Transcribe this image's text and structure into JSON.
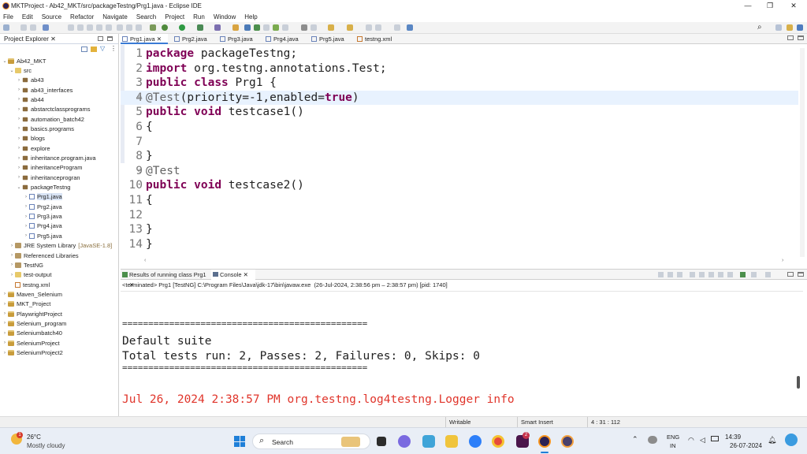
{
  "window": {
    "title": "MKTProject - Ab42_MKT/src/packageTestng/Prg1.java - Eclipse IDE",
    "controls": [
      "—",
      "❐",
      "✕"
    ]
  },
  "menu": [
    "File",
    "Edit",
    "Source",
    "Refactor",
    "Navigate",
    "Search",
    "Project",
    "Run",
    "Window",
    "Help"
  ],
  "explorer": {
    "title": "Project Explorer",
    "close": "✕",
    "tree": [
      {
        "label": "Ab42_MKT",
        "type": "proj",
        "twisty": "⌄"
      },
      {
        "label": "src",
        "type": "fold",
        "twisty": "⌄"
      },
      {
        "label": "ab43",
        "type": "pkg",
        "twisty": "›"
      },
      {
        "label": "ab43_interfaces",
        "type": "pkg",
        "twisty": "›"
      },
      {
        "label": "ab44",
        "type": "pkg",
        "twisty": "›"
      },
      {
        "label": "abstarctclassprograms",
        "type": "pkg",
        "twisty": "›"
      },
      {
        "label": "automation_batch42",
        "type": "pkg",
        "twisty": "›"
      },
      {
        "label": "basics.programs",
        "type": "pkg",
        "twisty": "›"
      },
      {
        "label": "blogs",
        "type": "pkg",
        "twisty": "›"
      },
      {
        "label": "explore",
        "type": "pkg",
        "twisty": "›"
      },
      {
        "label": "inheritance.program.java",
        "type": "pkg",
        "twisty": "›"
      },
      {
        "label": "inheritanceProgram",
        "type": "pkg",
        "twisty": "›"
      },
      {
        "label": "inheritanceprogran",
        "type": "pkg",
        "twisty": "›"
      },
      {
        "label": "packageTestng",
        "type": "pkg",
        "twisty": "⌄"
      },
      {
        "label": "Prg1.java",
        "type": "java",
        "twisty": "›",
        "selected": true
      },
      {
        "label": "Prg2.java",
        "type": "java",
        "twisty": "›"
      },
      {
        "label": "Prg3.java",
        "type": "java",
        "twisty": "›"
      },
      {
        "label": "Prg4.java",
        "type": "java",
        "twisty": "›"
      },
      {
        "label": "Prg5.java",
        "type": "java",
        "twisty": "›"
      },
      {
        "label": "JRE System Library",
        "type": "lib",
        "twisty": "›",
        "suffix": "[JavaSE-1.8]"
      },
      {
        "label": "Referenced Libraries",
        "type": "lib",
        "twisty": "›"
      },
      {
        "label": "TestNG",
        "type": "lib",
        "twisty": "›"
      },
      {
        "label": "test-output",
        "type": "fold",
        "twisty": "›"
      },
      {
        "label": "testng.xml",
        "type": "xml",
        "twisty": ""
      },
      {
        "label": "Maven_Selenium",
        "type": "proj",
        "twisty": "›"
      },
      {
        "label": "MKT_Project",
        "type": "proj",
        "twisty": "›"
      },
      {
        "label": "PlaywrightProject",
        "type": "proj",
        "twisty": "›"
      },
      {
        "label": "Selenium_program",
        "type": "proj",
        "twisty": "›"
      },
      {
        "label": "Seleniumbatch40",
        "type": "proj",
        "twisty": "›"
      },
      {
        "label": "SeleniumProject",
        "type": "proj",
        "twisty": "›"
      },
      {
        "label": "SeleniumProject2",
        "type": "proj",
        "twisty": "›"
      }
    ]
  },
  "editor": {
    "tabs": [
      {
        "label": "Prg1.java",
        "active": true,
        "close": "✕"
      },
      {
        "label": "Prg2.java"
      },
      {
        "label": "Prg3.java"
      },
      {
        "label": "Prg4.java"
      },
      {
        "label": "Prg5.java"
      },
      {
        "label": "testng.xml"
      }
    ],
    "lines": [
      {
        "n": "1",
        "tokens": [
          {
            "t": "package",
            "c": "kw"
          },
          {
            "t": " packageTestng;"
          }
        ]
      },
      {
        "n": "2",
        "tokens": [
          {
            "t": "import",
            "c": "kw"
          },
          {
            "t": " org.testng.annotations.Test;"
          }
        ]
      },
      {
        "n": "3",
        "tokens": [
          {
            "t": "public",
            "c": "kw"
          },
          {
            "t": " "
          },
          {
            "t": "class",
            "c": "kw"
          },
          {
            "t": " Prg1 {"
          }
        ]
      },
      {
        "n": "4",
        "fold": "⊖",
        "hl": true,
        "tokens": [
          {
            "t": "@Test",
            "c": "an"
          },
          {
            "t": "(priority=-1,enabled="
          },
          {
            "t": "true",
            "c": "kw"
          },
          {
            "t": ")"
          }
        ]
      },
      {
        "n": "5",
        "tokens": [
          {
            "t": "public",
            "c": "kw"
          },
          {
            "t": " "
          },
          {
            "t": "void",
            "c": "kw"
          },
          {
            "t": " testcase1()"
          }
        ]
      },
      {
        "n": "6",
        "tokens": [
          {
            "t": "{"
          }
        ]
      },
      {
        "n": "7",
        "tokens": []
      },
      {
        "n": "8",
        "tokens": [
          {
            "t": "}"
          }
        ]
      },
      {
        "n": "9",
        "fold": "⊖",
        "tokens": [
          {
            "t": "@Test",
            "c": "an"
          }
        ]
      },
      {
        "n": "10",
        "tokens": [
          {
            "t": "public",
            "c": "kw"
          },
          {
            "t": " "
          },
          {
            "t": "void",
            "c": "kw"
          },
          {
            "t": " testcase2()"
          }
        ]
      },
      {
        "n": "11",
        "tokens": [
          {
            "t": "{"
          }
        ]
      },
      {
        "n": "12",
        "tokens": []
      },
      {
        "n": "13",
        "tokens": [
          {
            "t": "}"
          }
        ]
      },
      {
        "n": "14",
        "tokens": [
          {
            "t": "}"
          }
        ]
      }
    ]
  },
  "console": {
    "tabs": [
      {
        "label": "Results of running class Prg1",
        "close": "✕"
      },
      {
        "label": "Console",
        "active": true,
        "close": "✕"
      }
    ],
    "header": "<terminated> Prg1 [TestNG] C:\\Program Files\\Java\\jdk-17\\bin\\javaw.exe  (26-Jul-2024, 2:38:56 pm – 2:38:57 pm) [pid: 1740]",
    "separator": "===============================================",
    "suite": "Default suite",
    "summary": "Total tests run: 2, Passes: 2, Failures: 0, Skips: 0",
    "log": "Jul 26, 2024 2:38:57 PM org.testng.log4testng.Logger info"
  },
  "status": {
    "mode": "Writable",
    "insert": "Smart Insert",
    "position": "4 : 31 : 112"
  },
  "taskbar": {
    "weather_temp": "26°C",
    "weather_desc": "Mostly cloudy",
    "search": "Search",
    "lang": "ENG",
    "region": "IN",
    "time": "14:39",
    "date": "26-07-2024",
    "badge": "2"
  },
  "colors": {
    "keyword": "#7f0055",
    "annotation": "#646464",
    "console_error": "#e0352b",
    "line_highlight": "#e8f2fe"
  }
}
